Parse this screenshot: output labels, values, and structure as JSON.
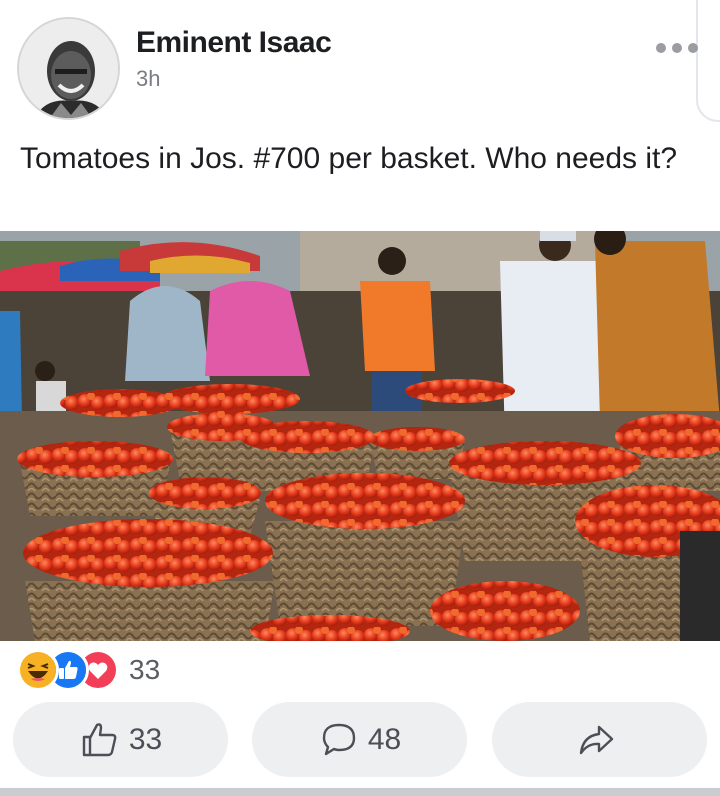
{
  "post": {
    "author": "Eminent Isaac",
    "time": "3h",
    "text": "Tomatoes in Jos. #700 per basket. Who needs it?",
    "reactions": {
      "icons": [
        "haha-icon",
        "like-icon",
        "love-icon"
      ],
      "count": "33"
    },
    "actions": {
      "like_count": "33",
      "comment_count": "48"
    }
  },
  "colors": {
    "like_blue": "#1877f2",
    "love_red": "#f33e58",
    "haha_yellow": "#f7b125",
    "tomato": "#e5391c"
  }
}
